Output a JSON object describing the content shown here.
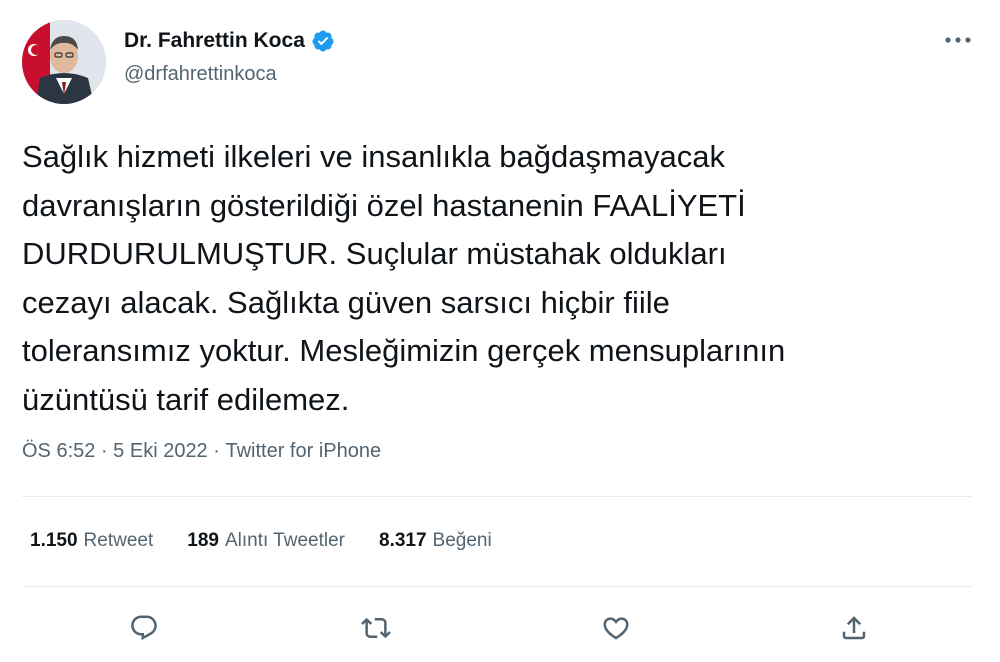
{
  "header": {
    "display_name": "Dr. Fahrettin Koca",
    "handle": "@drfahrettinkoca",
    "verified_icon": "verified-badge-icon",
    "verified_color": "#1d9bf0"
  },
  "tweet": {
    "text": "Sağlık hizmeti ilkeleri ve insanlıkla bağdaşmayacak\ndavranışların gösterildiği özel hastanenin FAALİYETİ\nDURDURULMUŞTUR. Suçlular müstahak oldukları\ncezayı alacak. Sağlıkta güven sarsıcı hiçbir fiile\ntoleransımız yoktur. Mesleğimizin gerçek mensuplarının\nüzüntüsü tarif edilemez.",
    "time": "ÖS 6:52",
    "separator": " · ",
    "date": "5 Eki 2022",
    "source": "Twitter for iPhone"
  },
  "stats": {
    "retweets_count": "1.150",
    "retweets_label": "Retweet",
    "quotes_count": "189",
    "quotes_label": "Alıntı Tweetler",
    "likes_count": "8.317",
    "likes_label": "Beğeni"
  },
  "actions": {
    "reply_icon": "reply-icon",
    "retweet_icon": "retweet-icon",
    "like_icon": "like-icon",
    "share_icon": "share-icon",
    "icon_color": "#536471"
  }
}
